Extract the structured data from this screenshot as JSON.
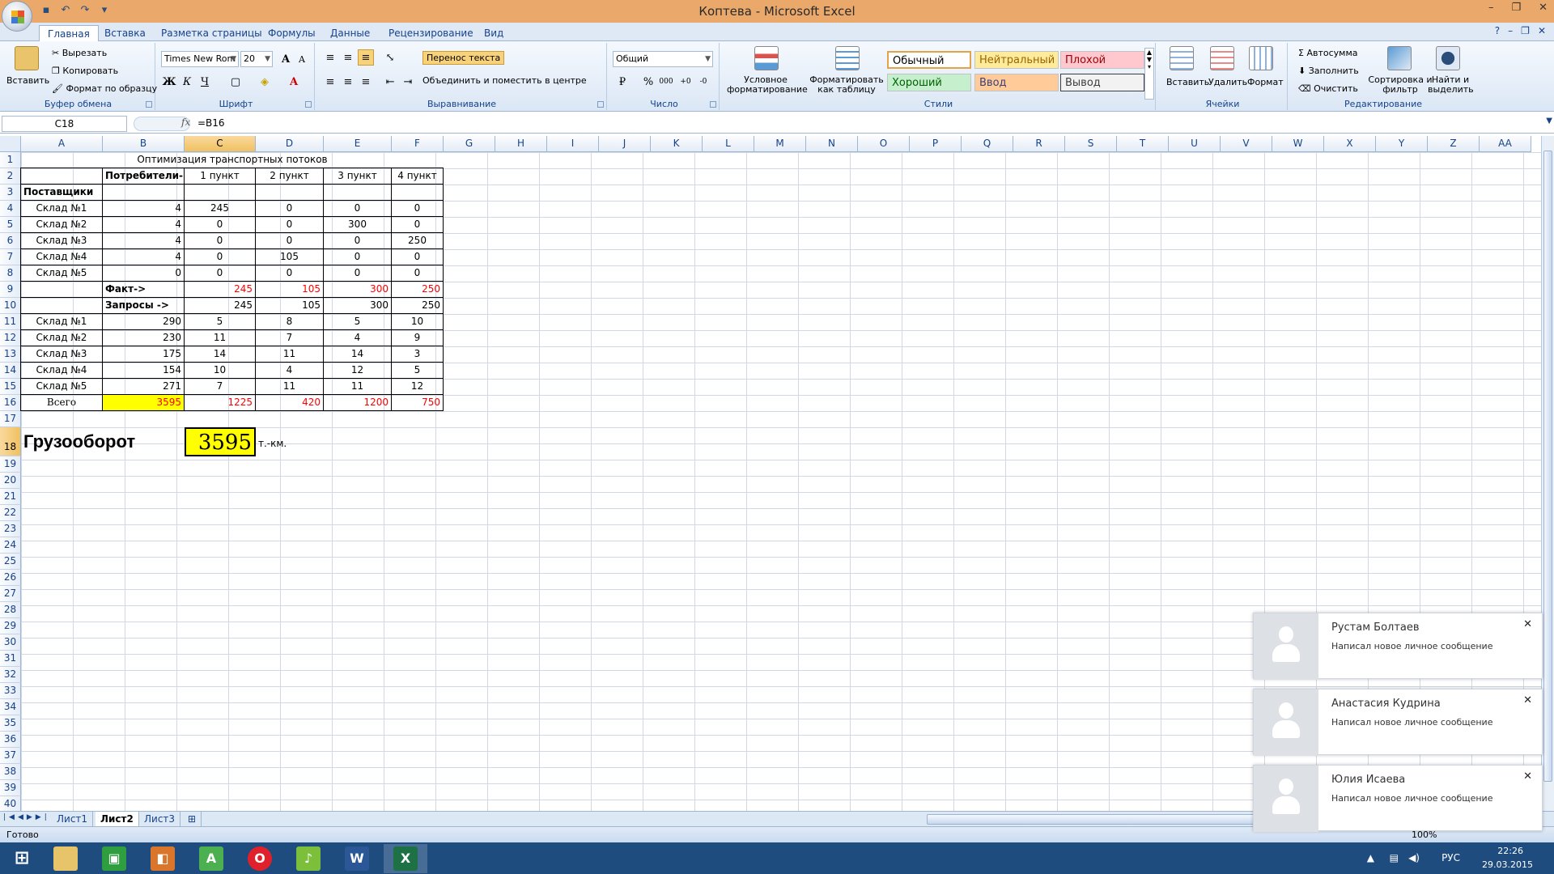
{
  "window": {
    "title": "Коптева - Microsoft Excel"
  },
  "ribbon_tabs": [
    "Главная",
    "Вставка",
    "Разметка страницы",
    "Формулы",
    "Данные",
    "Рецензирование",
    "Вид"
  ],
  "clipboard": {
    "paste": "Вставить",
    "cut": "Вырезать",
    "copy": "Копировать",
    "format_painter": "Формат по образцу",
    "label": "Буфер обмена"
  },
  "font": {
    "name": "Times New Rom",
    "size": "20",
    "label": "Шрифт",
    "bold": "Ж",
    "italic": "К",
    "underline": "Ч"
  },
  "alignment": {
    "wrap": "Перенос текста",
    "merge": "Объединить и поместить в центре",
    "label": "Выравнивание"
  },
  "number": {
    "format": "Общий",
    "label": "Число",
    "percent": "%",
    "thousands": "000"
  },
  "styles": {
    "conditional": "Условное форматирование",
    "as_table": "Форматировать как таблицу",
    "normal": "Обычный",
    "neutral": "Нейтральный",
    "bad": "Плохой",
    "good": "Хороший",
    "input": "Ввод",
    "output": "Вывод",
    "label": "Стили"
  },
  "cells": {
    "insert": "Вставить",
    "delete": "Удалить",
    "format": "Формат",
    "label": "Ячейки"
  },
  "editing": {
    "autosum": "Автосумма",
    "fill": "Заполнить",
    "clear": "Очистить",
    "sort": "Сортировка и фильтр",
    "find": "Найти и выделить",
    "label": "Редактирование"
  },
  "formula_bar": {
    "name_box": "C18",
    "formula": "=B16"
  },
  "columns": [
    "A",
    "B",
    "C",
    "D",
    "E",
    "F",
    "G",
    "H",
    "I",
    "J",
    "K",
    "L",
    "M",
    "N",
    "O",
    "P",
    "Q",
    "R",
    "S",
    "T",
    "U",
    "V",
    "W",
    "X",
    "Y",
    "Z",
    "AA"
  ],
  "rows": [
    "1",
    "2",
    "3",
    "4",
    "5",
    "6",
    "7",
    "8",
    "9",
    "10",
    "11",
    "12",
    "13",
    "14",
    "15",
    "16",
    "17",
    "18",
    "19",
    "20",
    "21",
    "22",
    "23",
    "24",
    "25",
    "26",
    "27",
    "28",
    "29",
    "30",
    "31",
    "32",
    "33",
    "34",
    "35",
    "36",
    "37",
    "38",
    "39",
    "40"
  ],
  "sheet": {
    "title": "Оптимизация транспортных потоков",
    "consumers_label": "Потребители->",
    "points": [
      "1 пункт",
      "2 пункт",
      "3 пункт",
      "4 пункт"
    ],
    "suppliers_label": "Поставщики",
    "warehouses": [
      "Склад №1",
      "Склад №2",
      "Склад №3",
      "Склад №4",
      "Склад №5"
    ],
    "plan_b": [
      "4",
      "4",
      "4",
      "4",
      "0"
    ],
    "plan": [
      [
        "245",
        "0",
        "0",
        "0"
      ],
      [
        "0",
        "0",
        "300",
        "0"
      ],
      [
        "0",
        "0",
        "0",
        "250"
      ],
      [
        "0",
        "105",
        "0",
        "0"
      ],
      [
        "0",
        "0",
        "0",
        "0"
      ]
    ],
    "fact_label": "Факт->",
    "fact": [
      "245",
      "105",
      "300",
      "250"
    ],
    "requests_label": "Запросы ->",
    "requests": [
      "245",
      "105",
      "300",
      "250"
    ],
    "supply": [
      "290",
      "230",
      "175",
      "154",
      "271"
    ],
    "costs": [
      [
        "5",
        "8",
        "5",
        "10"
      ],
      [
        "11",
        "7",
        "4",
        "9"
      ],
      [
        "14",
        "11",
        "14",
        "3"
      ],
      [
        "10",
        "4",
        "12",
        "5"
      ],
      [
        "7",
        "11",
        "11",
        "12"
      ]
    ],
    "total_label": "Всего",
    "total_b": "3595",
    "totals": [
      "1225",
      "420",
      "1200",
      "750"
    ],
    "turnover_label": "Грузооборот",
    "turnover_value": "3595",
    "unit": "т.-км."
  },
  "sheet_tabs": [
    "Лист1",
    "Лист2",
    "Лист3"
  ],
  "status": {
    "ready": "Готово",
    "zoom": "100%"
  },
  "notifications": [
    {
      "name": "Рустам Болтаев",
      "message": "Написал новое личное сообщение"
    },
    {
      "name": "Анастасия Кудрина",
      "message": "Написал новое личное сообщение"
    },
    {
      "name": "Юлия Исаева",
      "message": "Написал новое личное сообщение"
    }
  ],
  "taskbar": {
    "lang": "РУС",
    "time": "22:26",
    "date": "29.03.2015"
  },
  "colors": {
    "title_bar": "#eaa86a",
    "accent": "#15428b",
    "highlight": "#ffff00",
    "negative": "#ff0000",
    "taskbar": "#1f4c7f"
  }
}
